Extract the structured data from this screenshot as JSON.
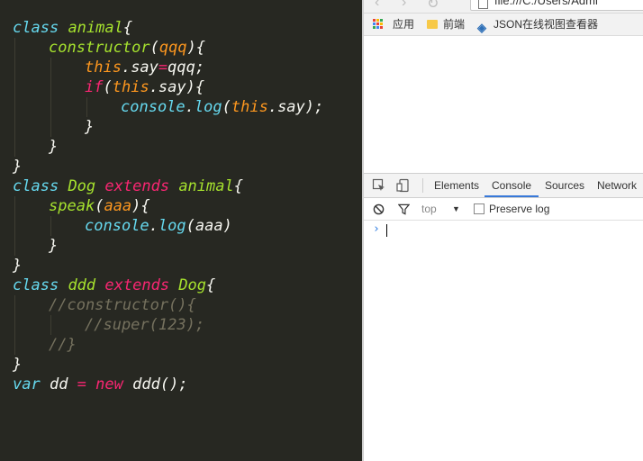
{
  "editor": {
    "lines": [
      {
        "indent": 0,
        "tokens": [
          {
            "t": "class",
            "c": "kw"
          },
          {
            "t": " "
          },
          {
            "t": "animal",
            "c": "cls"
          },
          {
            "t": "{",
            "c": "pl"
          }
        ]
      },
      {
        "indent": 1,
        "tokens": [
          {
            "t": "constructor",
            "c": "cls"
          },
          {
            "t": "(",
            "c": "pl"
          },
          {
            "t": "qqq",
            "c": "prm"
          },
          {
            "t": "){",
            "c": "pl"
          }
        ]
      },
      {
        "indent": 2,
        "tokens": [
          {
            "t": "this",
            "c": "thi"
          },
          {
            "t": ".say",
            "c": "pl"
          },
          {
            "t": "=",
            "c": "op"
          },
          {
            "t": "qqq;",
            "c": "pl"
          }
        ]
      },
      {
        "indent": 2,
        "tokens": [
          {
            "t": "if",
            "c": "kw2"
          },
          {
            "t": "(",
            "c": "pl"
          },
          {
            "t": "this",
            "c": "thi"
          },
          {
            "t": ".say){",
            "c": "pl"
          }
        ]
      },
      {
        "indent": 3,
        "tokens": [
          {
            "t": "console",
            "c": "fn"
          },
          {
            "t": ".",
            "c": "pl"
          },
          {
            "t": "log",
            "c": "fn"
          },
          {
            "t": "(",
            "c": "pl"
          },
          {
            "t": "this",
            "c": "thi"
          },
          {
            "t": ".say);",
            "c": "pl"
          }
        ]
      },
      {
        "indent": 2,
        "tokens": [
          {
            "t": "}",
            "c": "pl"
          }
        ]
      },
      {
        "indent": 1,
        "tokens": [
          {
            "t": "}",
            "c": "pl"
          }
        ]
      },
      {
        "indent": 0,
        "tokens": [
          {
            "t": "}",
            "c": "pl"
          }
        ]
      },
      {
        "indent": 0,
        "tokens": [
          {
            "t": "class",
            "c": "kw"
          },
          {
            "t": " "
          },
          {
            "t": "Dog",
            "c": "cls"
          },
          {
            "t": " "
          },
          {
            "t": "extends",
            "c": "kw2"
          },
          {
            "t": " "
          },
          {
            "t": "animal",
            "c": "cls"
          },
          {
            "t": "{",
            "c": "pl"
          }
        ]
      },
      {
        "indent": 1,
        "tokens": [
          {
            "t": "speak",
            "c": "cls"
          },
          {
            "t": "(",
            "c": "pl"
          },
          {
            "t": "aaa",
            "c": "prm"
          },
          {
            "t": "){",
            "c": "pl"
          }
        ]
      },
      {
        "indent": 2,
        "tokens": [
          {
            "t": "console",
            "c": "fn"
          },
          {
            "t": ".",
            "c": "pl"
          },
          {
            "t": "log",
            "c": "fn"
          },
          {
            "t": "(aaa)",
            "c": "pl"
          }
        ]
      },
      {
        "indent": 1,
        "tokens": [
          {
            "t": "}",
            "c": "pl"
          }
        ]
      },
      {
        "indent": 0,
        "tokens": [
          {
            "t": "}",
            "c": "pl"
          }
        ]
      },
      {
        "indent": 0,
        "tokens": [
          {
            "t": "class",
            "c": "kw"
          },
          {
            "t": " "
          },
          {
            "t": "ddd",
            "c": "cls"
          },
          {
            "t": " "
          },
          {
            "t": "extends",
            "c": "kw2"
          },
          {
            "t": " "
          },
          {
            "t": "Dog",
            "c": "cls"
          },
          {
            "t": "{",
            "c": "pl"
          }
        ]
      },
      {
        "indent": 1,
        "tokens": [
          {
            "t": "//constructor(){",
            "c": "cm"
          }
        ]
      },
      {
        "indent": 2,
        "tokens": [
          {
            "t": "//super(123);",
            "c": "cm"
          }
        ]
      },
      {
        "indent": 1,
        "tokens": [
          {
            "t": "//}",
            "c": "cm"
          }
        ]
      },
      {
        "indent": 0,
        "tokens": [
          {
            "t": "}",
            "c": "pl"
          }
        ]
      },
      {
        "indent": 0,
        "tokens": [
          {
            "t": "var",
            "c": "kw"
          },
          {
            "t": " dd ",
            "c": "pl"
          },
          {
            "t": "=",
            "c": "op"
          },
          {
            "t": " "
          },
          {
            "t": "new",
            "c": "kw2"
          },
          {
            "t": " ddd();",
            "c": "pl"
          }
        ]
      }
    ]
  },
  "browser": {
    "url": "file:///C:/Users/Admi",
    "bookmarks": [
      {
        "label": "应用",
        "icon": "apps-icon"
      },
      {
        "label": "前端",
        "icon": "folder-icon"
      },
      {
        "label": "JSON在线视图查看器",
        "icon": "json-icon"
      }
    ]
  },
  "devtools": {
    "tabs": [
      "Elements",
      "Console",
      "Sources",
      "Network"
    ],
    "active_tab": "Console",
    "context": "top",
    "preserve_log": "Preserve log",
    "prompt": "›"
  }
}
